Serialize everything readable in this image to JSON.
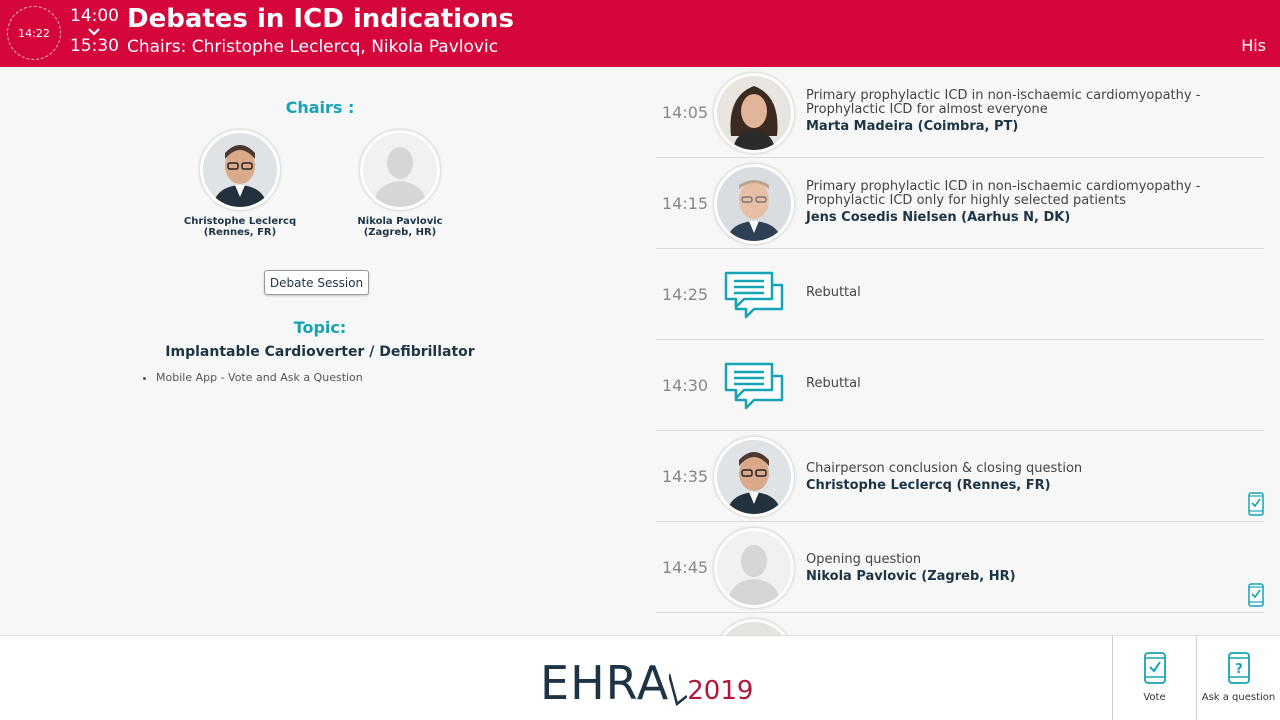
{
  "header": {
    "current_time": "14:22",
    "start_time": "14:00",
    "end_time": "15:30",
    "title": "Debates in ICD indications",
    "subtitle": "Chairs: Christophe Leclercq, Nikola Pavlovic",
    "right_text": "His",
    "bg_color": "#d5063c"
  },
  "left": {
    "chairs_heading": "Chairs :",
    "chairs": [
      {
        "name": "Christophe Leclercq",
        "location": "(Rennes, FR)",
        "photo": "photo"
      },
      {
        "name": "Nikola Pavlovic",
        "location": "(Zagreb, HR)",
        "photo": "placeholder-avatar"
      }
    ],
    "session_type": "Debate Session",
    "topic_heading": "Topic:",
    "topic_value": "Implantable Cardioverter / Defibrillator",
    "bullets": [
      "Mobile App - Vote and Ask a Question"
    ]
  },
  "schedule": [
    {
      "time": "14:05",
      "title": "Primary prophylactic ICD in non-ischaemic cardiomyopathy - Prophylactic ICD for almost everyone",
      "speaker": "Marta Madeira (Coimbra, PT)",
      "icon": "speaker-photo",
      "vote": false
    },
    {
      "time": "14:15",
      "title": "Primary prophylactic ICD in non-ischaemic cardiomyopathy - Prophylactic ICD only for highly selected patients",
      "speaker": "Jens Cosedis Nielsen (Aarhus N, DK)",
      "icon": "speaker-photo",
      "vote": false
    },
    {
      "time": "14:25",
      "title": "Rebuttal",
      "speaker": "",
      "icon": "chat-icon",
      "vote": false
    },
    {
      "time": "14:30",
      "title": "Rebuttal",
      "speaker": "",
      "icon": "chat-icon",
      "vote": false
    },
    {
      "time": "14:35",
      "title": "Chairperson conclusion & closing question",
      "speaker": "Christophe Leclercq (Rennes, FR)",
      "icon": "speaker-photo",
      "vote": true
    },
    {
      "time": "14:45",
      "title": "Opening question",
      "speaker": "Nikola Pavlovic (Zagreb, HR)",
      "icon": "placeholder-avatar",
      "vote": true
    }
  ],
  "footer": {
    "logo_text": "EHRA",
    "logo_year": "2019",
    "vote_label": "Vote",
    "ask_label": "Ask a question",
    "accent_color": "#17a3b6",
    "brand_color": "#1d3446"
  }
}
